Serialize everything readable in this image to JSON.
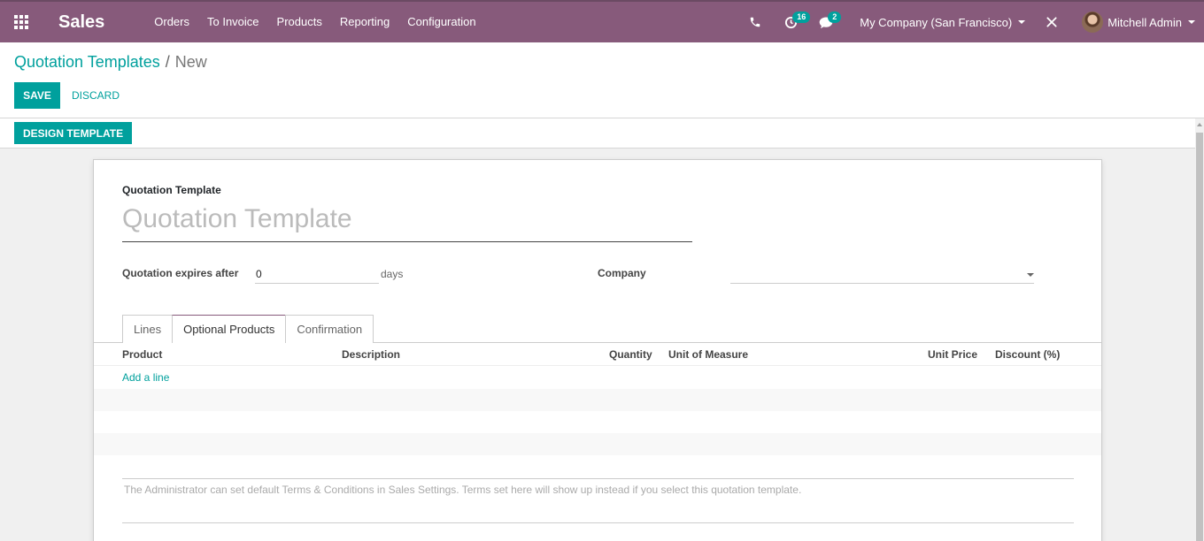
{
  "navbar": {
    "app_title": "Sales",
    "menu": [
      "Orders",
      "To Invoice",
      "Products",
      "Reporting",
      "Configuration"
    ],
    "activity_count": "16",
    "message_count": "2",
    "company": "My Company (San Francisco)",
    "user": "Mitchell Admin",
    "brand_color": "#875a7b"
  },
  "breadcrumb": {
    "parent": "Quotation Templates",
    "separator": "/",
    "current": "New"
  },
  "actions": {
    "save": "SAVE",
    "discard": "DISCARD",
    "design_template": "DESIGN TEMPLATE",
    "accent_color": "#00a09d"
  },
  "form": {
    "name_label": "Quotation Template",
    "name_placeholder": "Quotation Template",
    "expires_label": "Quotation expires after",
    "expires_value": "0",
    "expires_unit": "days",
    "company_label": "Company",
    "company_value": ""
  },
  "tabs": [
    "Lines",
    "Optional Products",
    "Confirmation"
  ],
  "active_tab": "Optional Products",
  "table": {
    "columns": [
      "Product",
      "Description",
      "Quantity",
      "Unit of Measure",
      "Unit Price",
      "Discount (%)"
    ],
    "add_line": "Add a line"
  },
  "terms_placeholder": "The Administrator can set default Terms & Conditions in Sales Settings. Terms set here will show up instead if you select this quotation template."
}
